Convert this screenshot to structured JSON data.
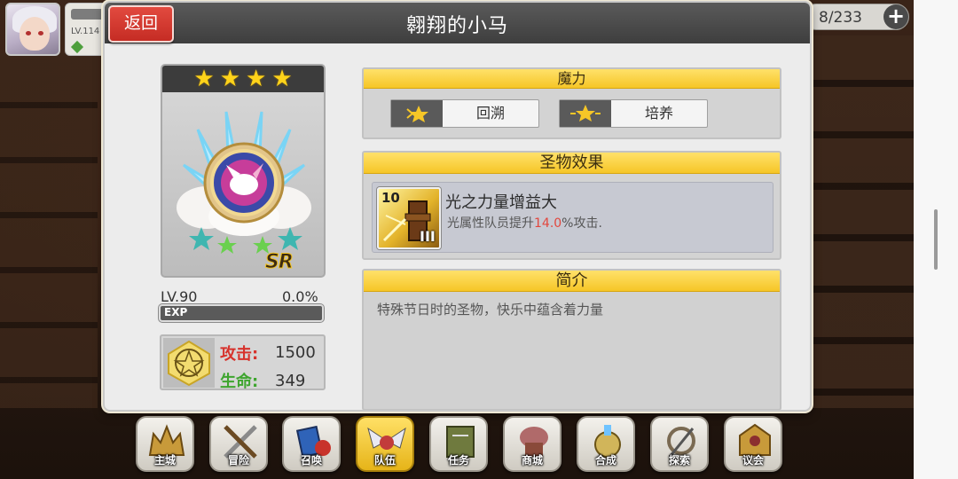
{
  "hud": {
    "player_level": "LV.114",
    "resource_count": "8/233",
    "add_symbol": "+"
  },
  "panel": {
    "title": "翱翔的小马",
    "back_label": "返回"
  },
  "relic": {
    "stars": 4,
    "star_glyph": "★",
    "rarity": "SR",
    "level": "LV.90",
    "exp_percent": "0.0%",
    "exp_fraction": 0.0,
    "exp_label": "EXP",
    "attack_label": "攻击:",
    "attack_value": "1500",
    "hp_label": "生命:",
    "hp_value": "349"
  },
  "magic": {
    "header": "魔力",
    "buttons": [
      {
        "label": "回溯",
        "icon": "star-rewind-icon"
      },
      {
        "label": "培养",
        "icon": "star-upgrade-icon"
      }
    ]
  },
  "effect": {
    "header": "圣物效果",
    "skill_level": "10",
    "skill_rank": "III",
    "skill_name": "光之力量增益大",
    "desc_prefix": "光属性队员提升",
    "desc_value": "14.0",
    "desc_suffix": "%攻击."
  },
  "intro": {
    "header": "简介",
    "text": "特殊节日时的圣物，快乐中蕴含着力量"
  },
  "nav": [
    {
      "label": "主城",
      "icon": "castle-icon"
    },
    {
      "label": "冒险",
      "icon": "crossed-swords-icon"
    },
    {
      "label": "召唤",
      "icon": "summon-cards-icon"
    },
    {
      "label": "队伍",
      "icon": "team-wings-icon"
    },
    {
      "label": "任务",
      "icon": "quest-book-icon"
    },
    {
      "label": "商城",
      "icon": "shop-icon"
    },
    {
      "label": "合成",
      "icon": "synthesis-icon"
    },
    {
      "label": "探索",
      "icon": "explore-icon"
    },
    {
      "label": "议会",
      "icon": "council-icon"
    }
  ],
  "colors": {
    "back_button": "#d63a31",
    "section_header": "#f6c627",
    "highlight_value": "#e2473e",
    "attack": "#d7322c",
    "hp": "#3ea52f"
  }
}
